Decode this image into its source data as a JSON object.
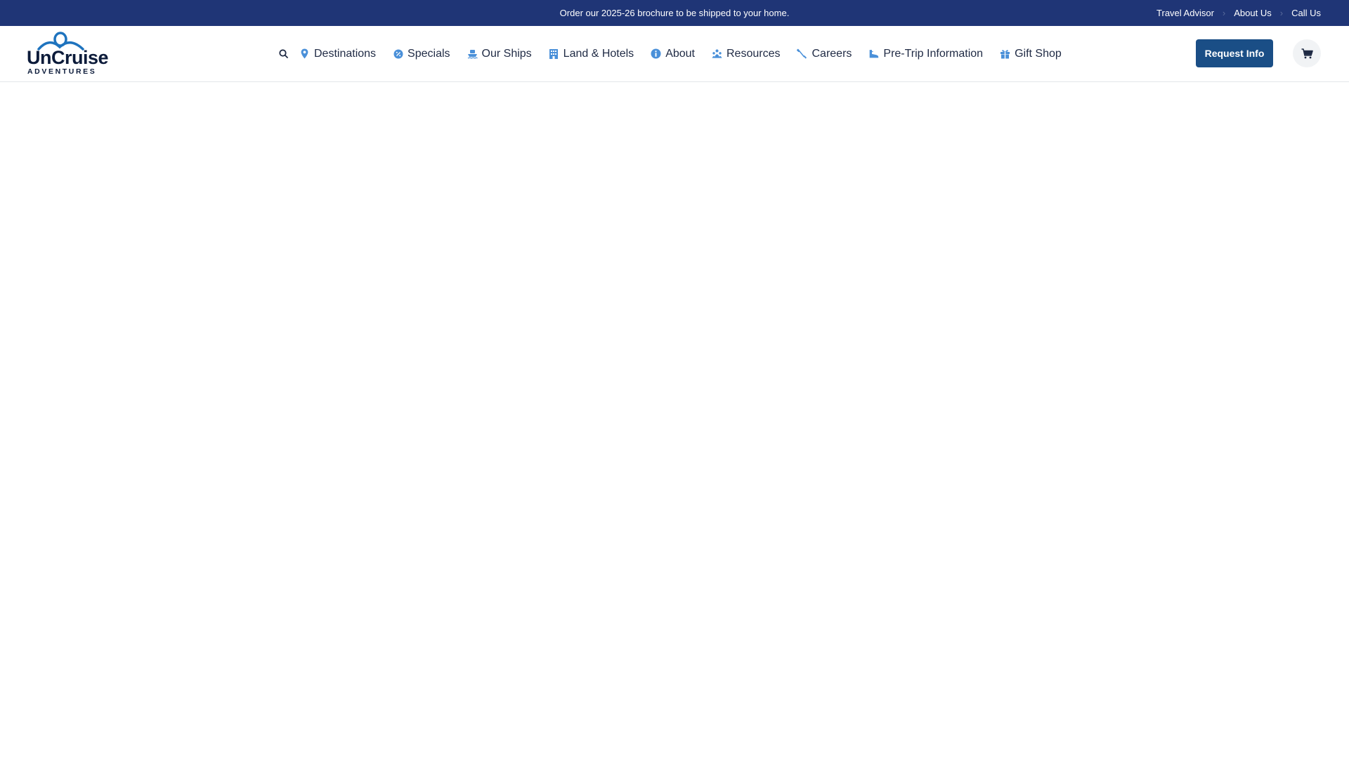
{
  "topbar": {
    "promo": "Order our 2025-26 brochure to be shipped to your home.",
    "links": [
      "Travel Advisor",
      "About Us",
      "Call Us"
    ]
  },
  "logo": {
    "word": "UnCruise",
    "sub": "ADVENTURES",
    "reg": "®"
  },
  "nav": {
    "items": [
      {
        "label": "Destinations",
        "icon": "map-pin-icon"
      },
      {
        "label": "Specials",
        "icon": "percent-badge-icon"
      },
      {
        "label": "Our Ships",
        "icon": "ship-icon"
      },
      {
        "label": "Land & Hotels",
        "icon": "hotel-icon"
      },
      {
        "label": "About",
        "icon": "info-icon"
      },
      {
        "label": "Resources",
        "icon": "people-group-icon"
      },
      {
        "label": "Careers",
        "icon": "paddle-icon"
      },
      {
        "label": "Pre-Trip Information",
        "icon": "boot-icon"
      },
      {
        "label": "Gift Shop",
        "icon": "gift-icon"
      }
    ]
  },
  "header": {
    "request_label": "Request Info"
  },
  "colors": {
    "topbar": "#1f3576",
    "accent": "#4a90d9",
    "button": "#1a4e86"
  }
}
